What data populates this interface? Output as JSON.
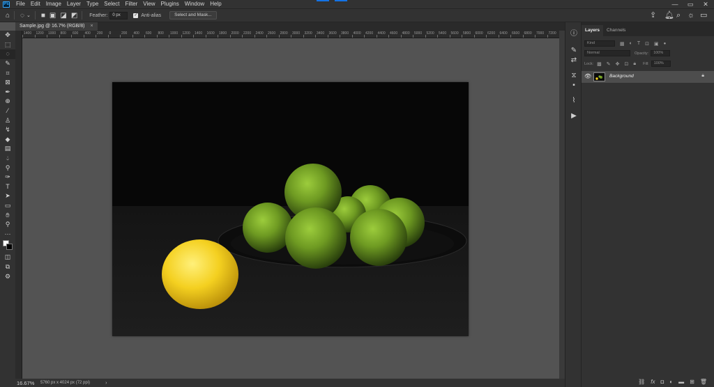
{
  "app": {
    "logo": "Ps"
  },
  "menu": [
    "File",
    "Edit",
    "Image",
    "Layer",
    "Type",
    "Select",
    "Filter",
    "View",
    "Plugins",
    "Window",
    "Help"
  ],
  "window_controls": {
    "minimize": "—",
    "maximize": "▭",
    "close": "✕"
  },
  "options_bar": {
    "feather_label": "Feather:",
    "feather_value": "0 px",
    "antialias_label": "Anti-alias",
    "antialias_checked": true,
    "select_mask_label": "Select and Mask..."
  },
  "document": {
    "tab_title": "Sample.jpg @ 16.7% (RGB/8)",
    "tab_close": "×"
  },
  "ruler_top": [
    "1400",
    "1200",
    "1000",
    "800",
    "600",
    "400",
    "200",
    "0",
    "200",
    "400",
    "600",
    "800",
    "1000",
    "1200",
    "1400",
    "1600",
    "1800",
    "2000",
    "2200",
    "2400",
    "2600",
    "2800",
    "3000",
    "3200",
    "3400",
    "3600",
    "3800",
    "4000",
    "4200",
    "4400",
    "4600",
    "4800",
    "5000",
    "5200",
    "5400",
    "5600",
    "5800",
    "6000",
    "6200",
    "6400",
    "6600",
    "6800",
    "7000",
    "7200"
  ],
  "status": {
    "zoom": "16.67%",
    "doc_info": "5760 px x 4024 px (72 ppi)",
    "arrow": "›"
  },
  "layers_panel": {
    "tabs": [
      "Layers",
      "Channels"
    ],
    "kind_placeholder": "Kind",
    "blend_mode": "Normal",
    "opacity_label": "Opacity:",
    "opacity_value": "100%",
    "lock_label": "Lock:",
    "fill_label": "Fill:",
    "fill_value": "100%",
    "layers": [
      {
        "name": "Background",
        "visible": true,
        "locked": true
      }
    ]
  },
  "icons": {
    "toolbar": [
      "move-icon",
      "marquee-icon",
      "lasso-icon",
      "quick-select-icon",
      "crop-icon",
      "frame-icon",
      "eyedropper-icon",
      "spot-heal-icon",
      "brush-icon",
      "stamp-icon",
      "history-brush-icon",
      "eraser-icon",
      "gradient-icon",
      "blur-icon",
      "dodge-icon",
      "pen-icon",
      "type-icon",
      "path-select-icon",
      "rectangle-icon",
      "hand-icon",
      "zoom-icon",
      "more-icon"
    ],
    "accent": "#31a8ff"
  }
}
